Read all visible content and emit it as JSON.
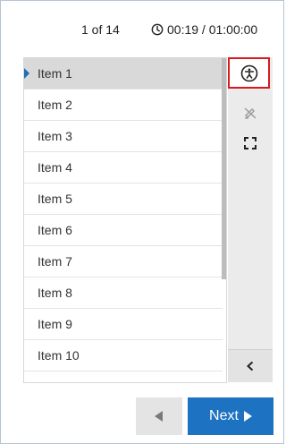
{
  "header": {
    "counter": "1 of 14",
    "timer": "00:19 / 01:00:00"
  },
  "list": {
    "items": [
      "Item 1",
      "Item 2",
      "Item 3",
      "Item 4",
      "Item 5",
      "Item 6",
      "Item 7",
      "Item 8",
      "Item 9",
      "Item 10"
    ],
    "active_index": 0
  },
  "side_toolbar": {
    "icons": [
      "accessibility-icon",
      "no-highlight-icon",
      "fullscreen-icon",
      "collapse-chevron-icon"
    ]
  },
  "navigation": {
    "next_label": "Next"
  },
  "colors": {
    "accent": "#1d72c1",
    "focus_outline": "#d9191c"
  }
}
